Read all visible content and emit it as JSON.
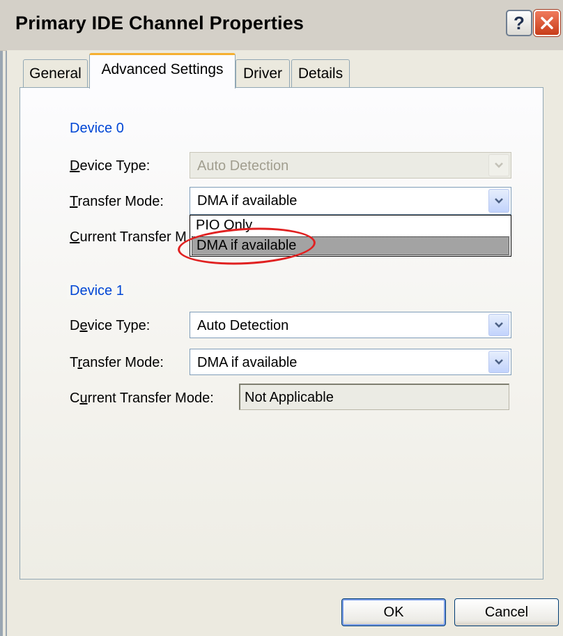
{
  "window": {
    "title": "Primary IDE Channel Properties",
    "help_glyph": "?"
  },
  "tabs": [
    {
      "label": "General"
    },
    {
      "label": "Advanced Settings",
      "selected": true
    },
    {
      "label": "Driver"
    },
    {
      "label": "Details"
    }
  ],
  "device0": {
    "legend": "Device 0",
    "device_type": {
      "label_first": "D",
      "label_rest": "evice Type:",
      "value": "Auto Detection",
      "disabled": true
    },
    "transfer_mode": {
      "label_first": "T",
      "label_rest": "ransfer Mode:",
      "value": "DMA if available"
    },
    "current_transfer": {
      "label_first": "C",
      "label_rest": "urrent Transfer M"
    },
    "dropdown_options": [
      "PIO Only",
      "DMA if available"
    ],
    "dropdown_selected": "DMA if available"
  },
  "device1": {
    "legend": "Device 1",
    "device_type": {
      "label_first": "D",
      "label_u": "e",
      "label_rest": "vice Type:",
      "value": "Auto Detection"
    },
    "transfer_mode": {
      "label_first": "T",
      "label_u": "r",
      "label_rest": "ansfer Mode:",
      "value": "DMA if available"
    },
    "current_transfer": {
      "label_first": "C",
      "label_u": "u",
      "label_rest": "rrent Transfer Mode:",
      "value": "Not Applicable"
    }
  },
  "buttons": {
    "ok": "OK",
    "cancel": "Cancel"
  },
  "colors": {
    "accent": "#0046d5",
    "tab_highlight": "#f5b031",
    "highlight_ring": "#e02020",
    "close_button": "#c83d1a"
  }
}
